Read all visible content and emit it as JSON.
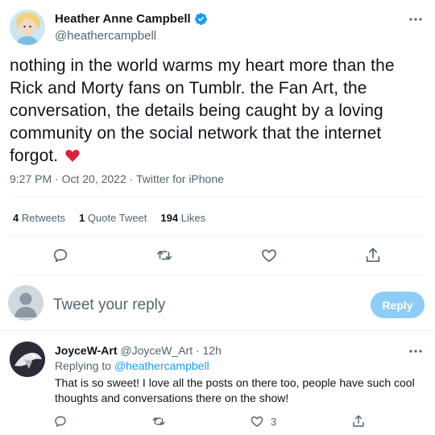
{
  "tweet": {
    "author_name": "Heather Anne Campbell",
    "author_handle": "@heathercampbell",
    "text": "nothing in the world warms my heart more than the Rick and Morty fans on Tumblr. the Fan Art, the conversation, the details being caught by a loving community on the social network that the internet forgot.",
    "emoji": "heart",
    "time": "9:27 PM",
    "date": "Oct 20, 2022",
    "source": "Twitter for iPhone",
    "stats": {
      "retweets_count": "4",
      "retweets_label": "Retweets",
      "quotes_count": "1",
      "quotes_label": "Quote Tweet",
      "likes_count": "194",
      "likes_label": "Likes"
    }
  },
  "compose": {
    "placeholder": "Tweet your reply",
    "button_label": "Reply"
  },
  "reply": {
    "author_name": "JoyceW-Art",
    "author_handle": "@JoyceW_Art",
    "age": "12h",
    "replying_prefix": "Replying to",
    "replying_to": "@heathercampbell",
    "text": "That is so sweet! I love all the posts on there too, people have such cool thoughts and conversations there on the show!",
    "like_count": "3"
  },
  "colors": {
    "accent": "#1d9bf0",
    "text": "#0f1419",
    "secondary": "#536471",
    "heart": "#e0245e",
    "reply_button_disabled": "#8ecdf8"
  }
}
